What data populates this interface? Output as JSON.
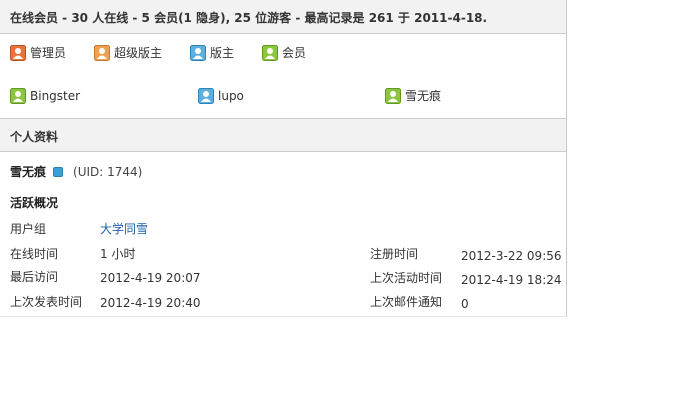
{
  "online_header": "在线会员 - 30 人在线 - 5 会员(1 隐身), 25 位游客 - 最高记录是 261 于 2011-4-18.",
  "legend": [
    {
      "label": "管理员",
      "icon": "admin-avatar-icon",
      "color": "#e8743b"
    },
    {
      "label": "超级版主",
      "icon": "super-moderator-avatar-icon",
      "color": "#f0a050"
    },
    {
      "label": "版主",
      "icon": "moderator-avatar-icon",
      "color": "#5bb0e0"
    },
    {
      "label": "会员",
      "icon": "member-avatar-icon",
      "color": "#8cc63f"
    }
  ],
  "online_users": [
    {
      "name": "Bingster",
      "icon": "member-avatar-icon",
      "color": "#8cc63f"
    },
    {
      "name": "lupo",
      "icon": "moderator-avatar-icon",
      "color": "#5bb0e0"
    },
    {
      "name": "雪无痕",
      "icon": "member-avatar-icon",
      "color": "#8cc63f"
    }
  ],
  "profile": {
    "header": "个人资料",
    "name": "雪无痕",
    "uid": "(UID: 1744)",
    "activity_title": "活跃概况",
    "fields": {
      "group_label": "用户组",
      "group_value": "大学同雪",
      "online_time_label": "在线时间",
      "online_time_value": "1 小时",
      "register_label": "注册时间",
      "register_value": "2012-3-22 09:56",
      "last_visit_label": "最后访问",
      "last_visit_value": "2012-4-19 20:07",
      "last_activity_label": "上次活动时间",
      "last_activity_value": "2012-4-19 18:24",
      "last_post_label": "上次发表时间",
      "last_post_value": "2012-4-19 20:40",
      "last_email_label": "上次邮件通知",
      "last_email_value": "0"
    }
  }
}
